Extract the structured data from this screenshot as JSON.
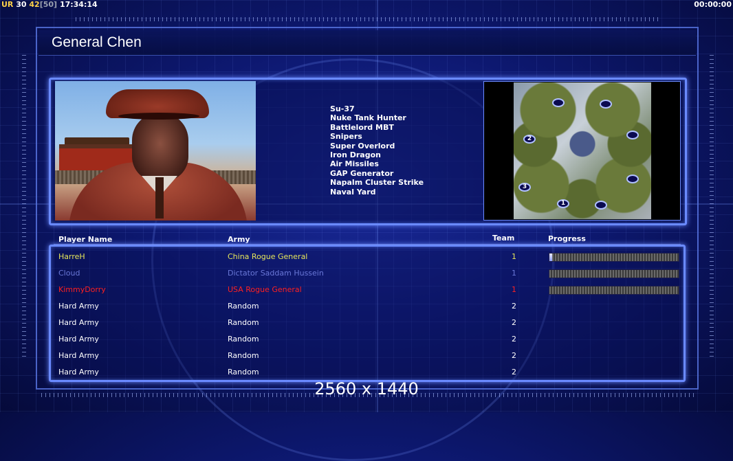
{
  "hud": {
    "tag": "UR",
    "fps": "30",
    "fps_target": "42",
    "fps_cap": "[50]",
    "clock": "17:34:14",
    "game_timer": "00:00:00"
  },
  "title": "General Chen",
  "units": [
    "Su-37",
    "Nuke Tank Hunter",
    "Battlelord MBT",
    "Snipers",
    "Super Overlord",
    "Iron Dragon",
    "Air Missiles",
    "GAP Generator",
    "Napalm Cluster Strike",
    "Naval Yard"
  ],
  "minimap": {
    "spawns": [
      "",
      "",
      "2",
      "",
      "",
      "3",
      "1",
      ""
    ]
  },
  "table": {
    "headers": {
      "player": "Player Name",
      "army": "Army",
      "team": "Team",
      "progress": "Progress"
    },
    "rows": [
      {
        "name": "HarreH",
        "army": "China Rogue General",
        "team": "1",
        "color": "#e6e65a",
        "progress": 0.02,
        "show_progress": true
      },
      {
        "name": "Cloud",
        "army": "Dictator Saddam Hussein",
        "team": "1",
        "color": "#6a78d8",
        "progress": 0,
        "show_progress": true
      },
      {
        "name": "KimmyDorry",
        "army": "USA Rogue General",
        "team": "1",
        "color": "#ff2020",
        "progress": 0,
        "show_progress": true
      },
      {
        "name": "Hard Army",
        "army": "Random",
        "team": "2",
        "color": "#ffffff",
        "progress": 0,
        "show_progress": false
      },
      {
        "name": "Hard Army",
        "army": "Random",
        "team": "2",
        "color": "#ffffff",
        "progress": 0,
        "show_progress": false
      },
      {
        "name": "Hard Army",
        "army": "Random",
        "team": "2",
        "color": "#ffffff",
        "progress": 0,
        "show_progress": false
      },
      {
        "name": "Hard Army",
        "army": "Random",
        "team": "2",
        "color": "#ffffff",
        "progress": 0,
        "show_progress": false
      },
      {
        "name": "Hard Army",
        "army": "Random",
        "team": "2",
        "color": "#ffffff",
        "progress": 0,
        "show_progress": false
      }
    ]
  },
  "resolution": "2560 x 1440"
}
